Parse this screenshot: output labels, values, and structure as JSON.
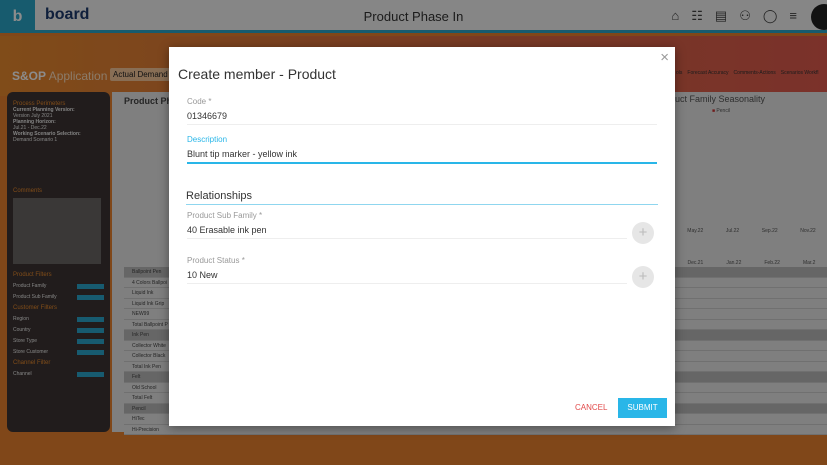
{
  "topbar": {
    "logo_letter": "b",
    "logo_word": "board",
    "title": "Product Phase In",
    "icons": [
      "home-icon",
      "hierarchy-icon",
      "document-icon",
      "users-icon",
      "chat-icon",
      "menu-icon"
    ]
  },
  "app": {
    "name_bold": "S&OP",
    "name_rest": " Application",
    "tabs": [
      "Actual Demand"
    ],
    "right_tabs": [
      "ols",
      "Forecast Accuracy",
      "Comments-Actions",
      "Scenarios Workfl"
    ]
  },
  "left_panel": {
    "process_title": "Process Perimeters",
    "planning_version_label": "Current Planning Version:",
    "planning_version": "Version July 2021",
    "horizon_label": "Planning Horizon:",
    "horizon": "Jul.21 - Dec.22",
    "scenario_label": "Working Scenario Selection:",
    "scenario": "Demand Scenario 1",
    "comments_title": "Comments",
    "product_filters_title": "Product Filters",
    "product_filters": [
      "Product Family",
      "Product Sub Family"
    ],
    "customer_filters_title": "Customer Filters",
    "customer_filters": [
      "Region",
      "Country",
      "Store Type",
      "Store Customer"
    ],
    "channel_filter_title": "Channel Filter",
    "channel_filters": [
      "Channel"
    ]
  },
  "main": {
    "title": "Product Pha",
    "chart_title": "duct Family Seasonality",
    "legend": "Pencil",
    "months": [
      "May.22",
      "Jul.22",
      "Sep.22",
      "Nov.22"
    ],
    "table_months": [
      "Dec.21",
      "Jan.22",
      "Feb.22",
      "Mar.2"
    ],
    "rows": [
      "Ballpoint Pen",
      "4 Colors Ballpoi",
      "Liquid Ink",
      "Liquid Ink Grip",
      "NEW99",
      "Total Ballpoint P",
      "Ink Pen",
      "Collector White",
      "Collector Black",
      "Total Ink Pen",
      "Felt",
      "Old School",
      "Total Felt",
      "Pencil",
      "HiTec",
      "Hi-Precision"
    ]
  },
  "modal": {
    "title": "Create member - Product",
    "code_label": "Code *",
    "code_value": "01346679",
    "description_label": "Description",
    "description_value": "Blunt tip marker - yellow ink",
    "relationships_title": "Relationships",
    "subfamily_label": "Product Sub Family *",
    "subfamily_value": "40 Erasable ink pen",
    "status_label": "Product Status *",
    "status_value": "10 New",
    "cancel_label": "CANCEL",
    "submit_label": "SUBMIT",
    "close_icon": "×",
    "plus_icon": "+"
  },
  "colors": {
    "accent": "#29b6e8",
    "brand_teal": "#2aa6c8",
    "orange": "#e98a2e",
    "cancel": "#e24a4a"
  }
}
